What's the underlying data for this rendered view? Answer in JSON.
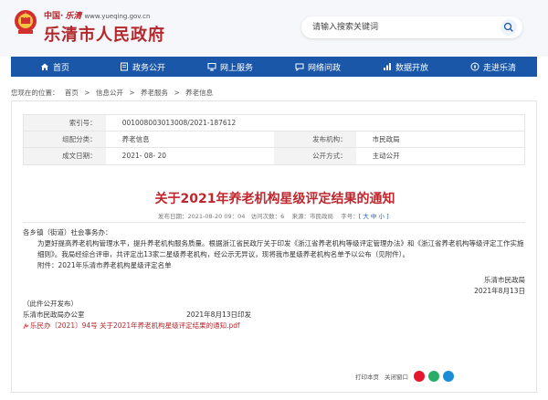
{
  "header": {
    "site_name_top": "中国·",
    "calligraphy": "乐清",
    "url": "www.yueqing.gov.cn",
    "title": "乐清市人民政府",
    "search_placeholder": "请输入搜索关键词"
  },
  "nav": {
    "items": [
      {
        "label": "首页",
        "icon": "home-icon"
      },
      {
        "label": "政务公开",
        "icon": "document-icon"
      },
      {
        "label": "网上服务",
        "icon": "monitor-icon"
      },
      {
        "label": "网络问政",
        "icon": "chat-icon"
      },
      {
        "label": "数据开放",
        "icon": "data-icon"
      },
      {
        "label": "走进乐清",
        "icon": "compass-icon"
      }
    ]
  },
  "breadcrumb": {
    "prefix": "您现在的位置：",
    "items": [
      "首页",
      "信息公开",
      "养老服务",
      "养老信息"
    ],
    "sep": ">"
  },
  "meta": {
    "index_label": "索引号：",
    "index_value": "001008003013008/2021-187612",
    "category_label": "组配分类：",
    "category_value": "养老信息",
    "publisher_label": "发布机构：",
    "publisher_value": "市民政局",
    "date_label": "成文日期：",
    "date_value": "2021- 08- 20",
    "mode_label": "公开方式：",
    "mode_value": "主动公开"
  },
  "article": {
    "title": "关于2021年养老机构星级评定结果的通知",
    "publish_time_label": "发布日期：",
    "publish_time": "2021-08-20 09：04",
    "views_label": "访问次数：",
    "views": "6",
    "source_label": "来源：",
    "source": "市民政局",
    "font_label": "字号：",
    "font_sizes": "[ 大 中 小 ]",
    "greeting": "各乡镇（街道）社会事务办：",
    "para1": "为更好提高养老机构管理水平，提升养老机构服务质量。根据浙江省民政厅关于印发《浙江省养老机构等级评定管理办法》和《浙江省养老机构等级评定工作实施细则》。我局经综合评审，共评定出13家二星级养老机构，经公示无异议，现将我市星级养老机构名单予以公布（见附件）。",
    "attachment": "附件：2021年乐清市养老机构星级评定名单",
    "sign_org": "乐清市民政局",
    "sign_date": "2021年8月13日",
    "publish_note": "（此件公开发布）",
    "office": "乐清市民政局办公室",
    "office_date": "2021年8月13日印发",
    "pdf_link": "乐民办〔2021〕94号 关于2021年养老机构星级评定结果的通知.pdf"
  },
  "tools": {
    "print": "打印本页",
    "close": "关闭窗口"
  },
  "colors": {
    "brand_red": "#b3282d",
    "nav_blue": "#1a57a8"
  }
}
